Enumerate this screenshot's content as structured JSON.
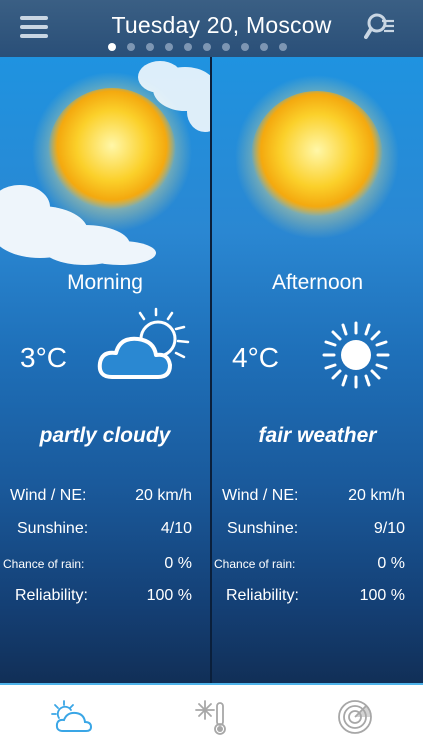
{
  "header": {
    "title": "Tuesday 20, Moscow",
    "page_indicator": {
      "total": 10,
      "active": 1
    },
    "icons": [
      "menu-icon",
      "search-list-icon"
    ]
  },
  "panels": [
    {
      "period": "Morning",
      "temperature": "3°C",
      "condition": "partly cloudy",
      "icon": "partly-cloudy-icon",
      "details": [
        {
          "label": "Wind / NE:",
          "value": "20 km/h"
        },
        {
          "label": "Sunshine:",
          "value": "4/10"
        },
        {
          "label": "Chance of rain:",
          "value": "0 %"
        },
        {
          "label": "Reliability:",
          "value": "100 %"
        }
      ]
    },
    {
      "period": "Afternoon",
      "temperature": "4°C",
      "condition": "fair weather",
      "icon": "sun-icon",
      "details": [
        {
          "label": "Wind / NE:",
          "value": "20 km/h"
        },
        {
          "label": "Sunshine:",
          "value": "9/10"
        },
        {
          "label": "Chance of rain:",
          "value": "0 %"
        },
        {
          "label": "Reliability:",
          "value": "100 %"
        }
      ]
    }
  ],
  "tabbar": {
    "tabs": [
      {
        "icon": "weather-tab-icon",
        "active": true
      },
      {
        "icon": "temperature-snow-icon",
        "active": false
      },
      {
        "icon": "radar-icon",
        "active": false
      }
    ],
    "active_color": "#3aa6e6",
    "inactive_color": "#a7a7a7"
  },
  "colors": {
    "header_bg": "#2f5580",
    "sky_top": "#1f93e0",
    "sky_bottom": "#112f57",
    "sun": "#f7c21e"
  }
}
